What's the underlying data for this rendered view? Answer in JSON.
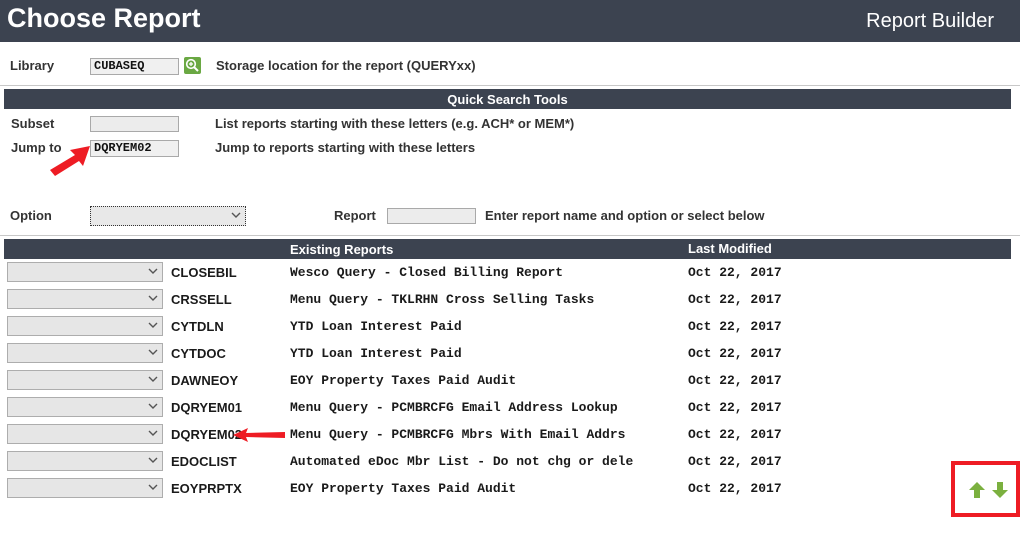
{
  "header": {
    "title": "Choose Report",
    "app_name": "Report Builder"
  },
  "library": {
    "label": "Library",
    "value": "CUBASEQ",
    "hint": "Storage location for the report (QUERYxx)"
  },
  "quick_search": {
    "title": "Quick Search Tools",
    "subset": {
      "label": "Subset",
      "value": "",
      "hint": "List reports starting with these letters (e.g. ACH* or MEM*)"
    },
    "jump_to": {
      "label": "Jump to",
      "value": "DQRYEM02",
      "hint": "Jump to reports starting with these letters"
    }
  },
  "option": {
    "label": "Option",
    "selected": ""
  },
  "report": {
    "label": "Report",
    "value": "",
    "hint": "Enter report name and option or select below"
  },
  "table": {
    "columns": {
      "existing": "Existing Reports",
      "modified": "Last Modified"
    },
    "rows": [
      {
        "name": "CLOSEBIL",
        "desc": "Wesco Query - Closed Billing Report",
        "modified": "Oct 22, 2017"
      },
      {
        "name": "CRSSELL",
        "desc": "Menu Query - TKLRHN Cross Selling Tasks",
        "modified": "Oct 22, 2017"
      },
      {
        "name": "CYTDLN",
        "desc": "YTD Loan Interest Paid",
        "modified": "Oct 22, 2017"
      },
      {
        "name": "CYTDOC",
        "desc": "YTD Loan Interest Paid",
        "modified": "Oct 22, 2017"
      },
      {
        "name": "DAWNEOY",
        "desc": "EOY Property Taxes Paid Audit",
        "modified": "Oct 22, 2017"
      },
      {
        "name": "DQRYEM01",
        "desc": "Menu Query - PCMBRCFG Email Address Lookup",
        "modified": "Oct 22, 2017"
      },
      {
        "name": "DQRYEM02",
        "desc": "Menu Query - PCMBRCFG Mbrs With Email Addrs",
        "modified": "Oct 22, 2017"
      },
      {
        "name": "EDOCLIST",
        "desc": "Automated eDoc Mbr List - Do not chg or dele",
        "modified": "Oct 22, 2017"
      },
      {
        "name": "EOYPRPTX",
        "desc": "EOY Property Taxes Paid Audit",
        "modified": "Oct 22, 2017"
      }
    ]
  },
  "colors": {
    "header": "#3c4350",
    "accent_green": "#6aa843",
    "annotation_red": "#ee1c24"
  },
  "icons": {
    "search": "magnifier-plus-icon",
    "up": "arrow-up-icon",
    "down": "arrow-down-icon",
    "chevron": "chevron-down-icon"
  }
}
